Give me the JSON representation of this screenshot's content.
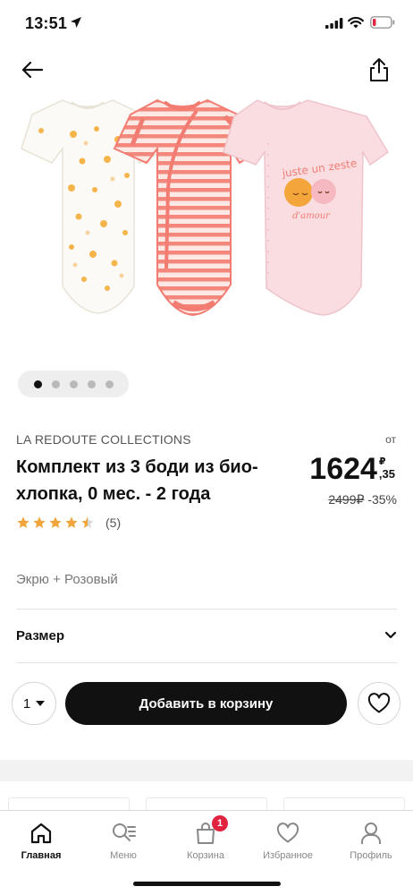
{
  "status_bar": {
    "time": "13:51"
  },
  "gallery": {
    "slides_total": 5,
    "active_index": 0,
    "print_text_line1": "juste un zeste",
    "print_text_line2": "d'amour"
  },
  "product": {
    "brand": "LA REDOUTE COLLECTIONS",
    "title": "Комплект из 3 боди из био-хлопка, 0 мес. - 2 года",
    "price_from_label": "от",
    "price_integer": "1624",
    "price_currency": "₽",
    "price_decimals": ",35",
    "old_price": "2499₽",
    "discount": "-35%",
    "rating": 4.5,
    "reviews_count": "(5)",
    "color": "Экрю + Розовый"
  },
  "size_selector": {
    "label": "Размер"
  },
  "purchase": {
    "quantity": "1",
    "add_to_cart_label": "Добавить в корзину"
  },
  "tabs": [
    {
      "label": "Главная",
      "icon": "home-icon",
      "active": true
    },
    {
      "label": "Меню",
      "icon": "menu-search-icon",
      "active": false
    },
    {
      "label": "Корзина",
      "icon": "cart-icon",
      "active": false,
      "badge": "1"
    },
    {
      "label": "Избранное",
      "icon": "heart-icon",
      "active": false
    },
    {
      "label": "Профиль",
      "icon": "profile-icon",
      "active": false
    }
  ],
  "colors": {
    "accent_dark": "#111111",
    "badge_red": "#e0243f",
    "star": "#f0a53c",
    "coral": "#f27c72",
    "light_pink": "#f9dde1"
  }
}
